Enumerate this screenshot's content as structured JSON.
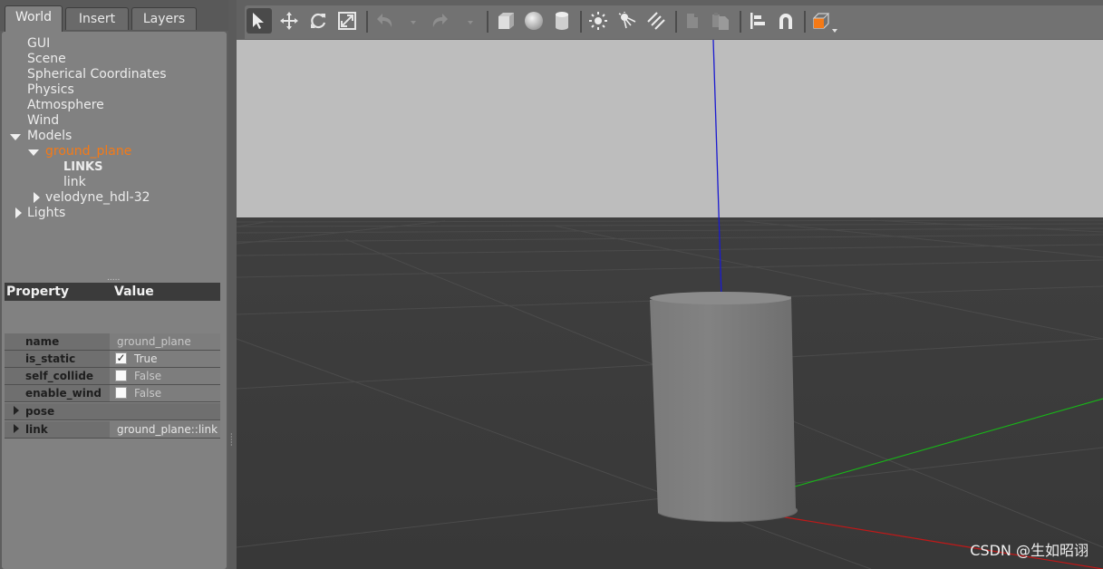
{
  "tabs": [
    {
      "label": "World",
      "active": true
    },
    {
      "label": "Insert",
      "active": false
    },
    {
      "label": "Layers",
      "active": false
    }
  ],
  "tree": {
    "gui": "GUI",
    "scene": "Scene",
    "spherical": "Spherical Coordinates",
    "physics": "Physics",
    "atmosphere": "Atmosphere",
    "wind": "Wind",
    "models": "Models",
    "ground_plane": "ground_plane",
    "links_header": "LINKS",
    "link": "link",
    "velodyne": "velodyne_hdl-32",
    "lights": "Lights"
  },
  "properties": {
    "header_property": "Property",
    "header_value": "Value",
    "rows": [
      {
        "key": "name",
        "value": "ground_plane"
      },
      {
        "key": "is_static",
        "value": "True",
        "checked": true
      },
      {
        "key": "self_collide",
        "value": "False",
        "checked": false
      },
      {
        "key": "enable_wind",
        "value": "False",
        "checked": false
      },
      {
        "key": "pose",
        "value": ""
      },
      {
        "key": "link",
        "value": "ground_plane::link"
      }
    ]
  },
  "toolbar": {
    "tools": [
      "select-arrow-icon",
      "translate-icon",
      "rotate-icon",
      "scale-icon",
      "undo-icon",
      "redo-icon",
      "box-icon",
      "sphere-icon",
      "cylinder-icon",
      "point-light-icon",
      "spot-light-icon",
      "directional-light-icon",
      "copy-icon",
      "paste-icon",
      "align-icon",
      "snap-icon",
      "view-angle-icon"
    ],
    "accent": "#f57a16"
  },
  "viewport": {
    "sky_color": "#bdbdbd",
    "ground_color": "#3a3a3a",
    "axis_colors": {
      "x": "#c21818",
      "y": "#17b817",
      "z": "#1a1ad0"
    }
  },
  "watermark": "CSDN @生如昭诩"
}
